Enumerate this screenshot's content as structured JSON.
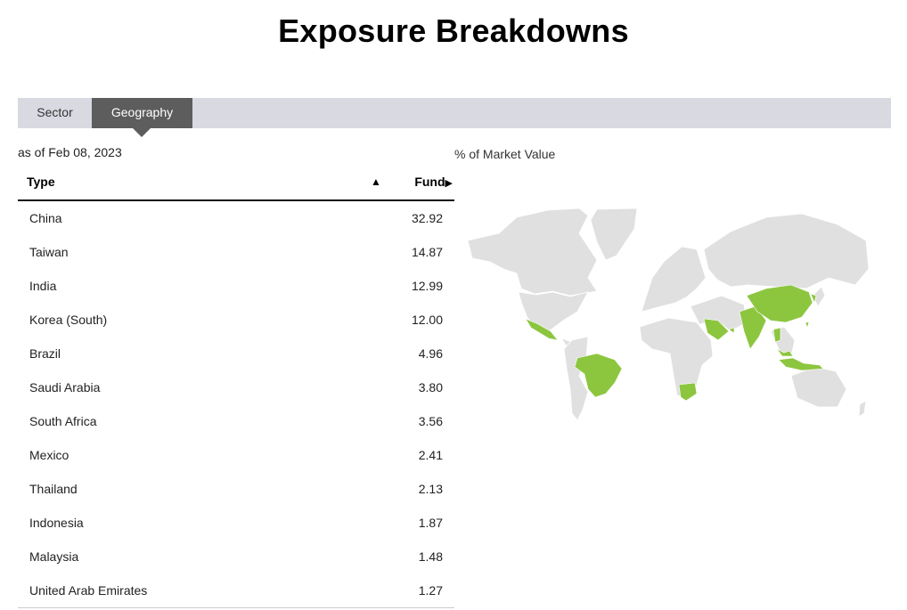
{
  "page": {
    "title": "Exposure Breakdowns"
  },
  "tabs": [
    {
      "label": "Sector",
      "active": false
    },
    {
      "label": "Geography",
      "active": true
    }
  ],
  "as_of": "as of Feb 08, 2023",
  "map_label": "% of Market Value",
  "table": {
    "headers": {
      "type": "Type",
      "sort_indicator": "▲",
      "fund": "Fund",
      "fund_arrow": "▶"
    },
    "rows": [
      {
        "name": "China",
        "value": "32.92"
      },
      {
        "name": "Taiwan",
        "value": "14.87"
      },
      {
        "name": "India",
        "value": "12.99"
      },
      {
        "name": "Korea (South)",
        "value": "12.00"
      },
      {
        "name": "Brazil",
        "value": "4.96"
      },
      {
        "name": "Saudi Arabia",
        "value": "3.80"
      },
      {
        "name": "South Africa",
        "value": "3.56"
      },
      {
        "name": "Mexico",
        "value": "2.41"
      },
      {
        "name": "Thailand",
        "value": "2.13"
      },
      {
        "name": "Indonesia",
        "value": "1.87"
      },
      {
        "name": "Malaysia",
        "value": "1.48"
      },
      {
        "name": "United Arab Emirates",
        "value": "1.27"
      }
    ]
  },
  "colors": {
    "highlight": "#8cc63f",
    "land": "#e0e0e0",
    "tab_active": "#5d5d5d",
    "tab_bar": "#d9d9e1"
  }
}
